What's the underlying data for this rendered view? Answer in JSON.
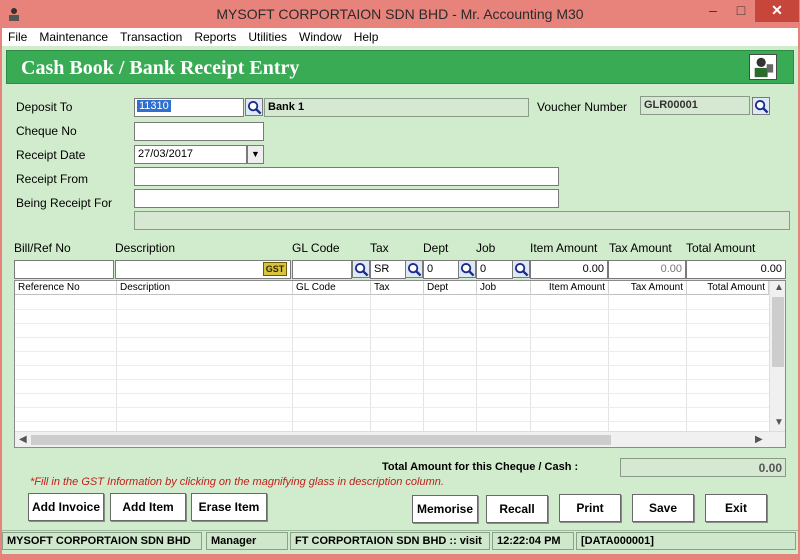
{
  "window": {
    "title": "MYSOFT CORPORTAION SDN BHD - Mr. Accounting M30",
    "min": "–",
    "max": "□",
    "close": "✕"
  },
  "menu": [
    "File",
    "Maintenance",
    "Transaction",
    "Reports",
    "Utilities",
    "Window",
    "Help"
  ],
  "form": {
    "title": "Cash Book / Bank Receipt Entry",
    "deposit_to_label": "Deposit To",
    "deposit_to_code": "11310",
    "deposit_to_name": "Bank 1",
    "voucher_number_label": "Voucher Number",
    "voucher_number": "GLR00001",
    "cheque_no_label": "Cheque No",
    "cheque_no": "",
    "receipt_date_label": "Receipt Date",
    "receipt_date": "27/03/2017",
    "receipt_from_label": "Receipt From",
    "receipt_from": "",
    "being_receipt_for_label": "Being Receipt For",
    "being_receipt_for": "",
    "being_receipt_for_2": ""
  },
  "entry": {
    "headers": {
      "bill_ref": "Bill/Ref No",
      "description": "Description",
      "gl_code": "GL Code",
      "tax": "Tax",
      "dept": "Dept",
      "job": "Job",
      "item_amount": "Item Amount",
      "tax_amount": "Tax Amount",
      "total_amount": "Total Amount"
    },
    "gst_label": "GST",
    "tax": "SR",
    "dept": "0",
    "job": "0",
    "item_amount": "0.00",
    "tax_amount": "0.00",
    "total_amount": "0.00"
  },
  "grid": {
    "columns": [
      "Reference No",
      "Description",
      "GL Code",
      "Tax",
      "Dept",
      "Job",
      "Item Amount",
      "Tax Amount",
      "Total Amount"
    ],
    "rows": []
  },
  "totals": {
    "label": "Total  Amount  for this Cheque / Cash :",
    "value": "0.00"
  },
  "note": "*Fill in the GST Information by clicking on the magnifying glass in description column.",
  "buttons": {
    "add_invoice": "Add Invoice",
    "add_item": "Add Item",
    "erase_item": "Erase Item",
    "memorise": "Memorise",
    "recall": "Recall",
    "print": "Print",
    "save": "Save",
    "exit": "Exit"
  },
  "status": {
    "company": "MYSOFT CORPORTAION SDN BHD",
    "user": "Manager",
    "info": "FT CORPORTAION SDN BHD  :: visit",
    "time": "12:22:04 PM",
    "data": "[DATA000001]"
  },
  "colors": {
    "titlebar": "#e8837c",
    "header": "#3aab55",
    "client": "#d1eccc",
    "close": "#c7463c",
    "note": "#c0201a"
  }
}
